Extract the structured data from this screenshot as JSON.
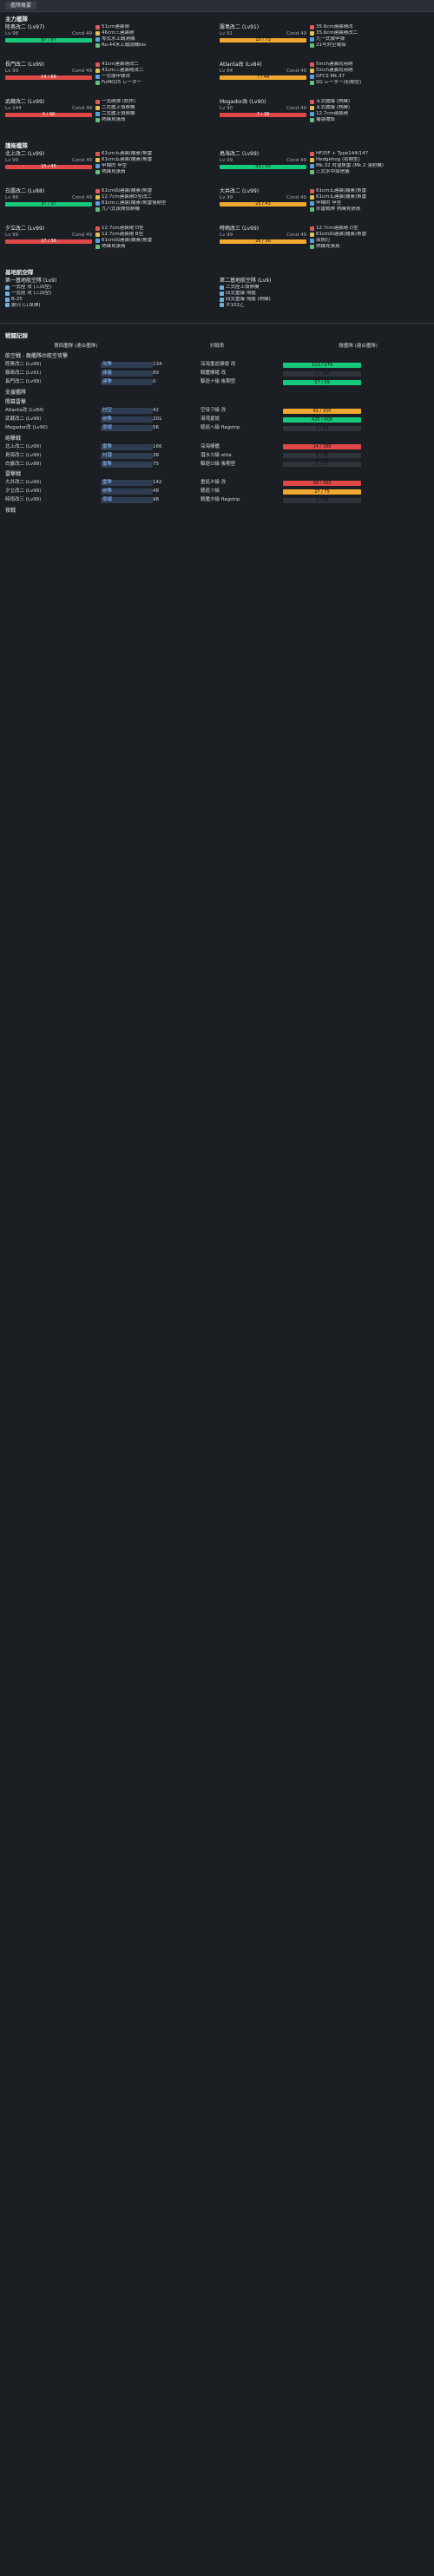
{
  "header": {
    "tab_label": "艦隊概要"
  },
  "sections": {
    "main_fleet": "主力艦隊",
    "escort_fleet": "護衛艦隊",
    "land_base": "基地航空隊",
    "battle_title": "戦闘記録",
    "phase_air": "航空戦 - 敵艦隊の航空攻撃",
    "phase_support": "支援艦隊",
    "phase_opening": "開幕雷撃",
    "phase_shelling": "砲撃戦",
    "phase_torpedo": "雷撃戦",
    "phase_night": "夜戦"
  },
  "fleet_ships": [
    {
      "name": "陸奥改二 (Lv97)",
      "lv": "Lv 98",
      "cond": "Cond 49",
      "hp": "97 / 97",
      "hp_color": "green",
      "equip": [
        "51cm連装砲",
        "46cm三連装砲",
        "零式水上観測機",
        "Ro.44水上戦闘機bis"
      ]
    },
    {
      "name": "霧島改二 (Lv91)",
      "lv": "Lv 91",
      "cond": "Cond 49",
      "hp": "10 / 73",
      "hp_color": "orange",
      "equip": [
        "35.6cm連装砲改",
        "35.6cm連装砲改二",
        "九一式徹甲弾",
        "21号対空電探"
      ]
    },
    {
      "name": "長門改二 (Lv99)",
      "lv": "Lv 99",
      "cond": "Cond 49",
      "hp": "14 / 66",
      "hp_color": "red",
      "equip": [
        "41cm連装砲改二",
        "41cm三連装砲改二",
        "一式徹甲弾改",
        "FuMO25 レーダー"
      ]
    },
    {
      "name": "Atlanta改 (Lv84)",
      "lv": "Lv 84",
      "cond": "Cond 49",
      "hp": "7 / 49",
      "hp_color": "orange",
      "equip": [
        "5inch連装両用砲",
        "5inch連装両用砲",
        "GFCS Mk.37",
        "SG レーダー(初期型)"
      ]
    },
    {
      "name": "武蔵改二 (Lv99)",
      "lv": "Lv 144",
      "cond": "Cond 49",
      "hp": "3 / 98",
      "hp_color": "red",
      "equip": [
        "一式砲弾 (試作)",
        "二式艦上偵察機",
        "二式艦上偵察機",
        "熟練見張員"
      ]
    },
    {
      "name": "Mogador改 (Lv90)",
      "lv": "Lv 90",
      "cond": "Cond 49",
      "hp": "7 / 38",
      "hp_color": "red",
      "equip": [
        "五式艦爆 (熟練)",
        "五式艦爆 (熟練)",
        "12.7cm連装砲",
        "補強増設"
      ]
    }
  ],
  "escort_ships": [
    {
      "name": "北上改二 (Lv99)",
      "lv": "Lv 99",
      "cond": "Cond 49",
      "hp": "15 / 45",
      "hp_color": "red",
      "equip": [
        "61cm五連装(酸素)魚雷",
        "61cm五連装(酸素)魚雷",
        "甲標的 甲型",
        "熟練見張員"
      ]
    },
    {
      "name": "鳥海改二 (Lv99)",
      "lv": "Lv 99",
      "cond": "Cond 49",
      "hp": "59 / 59",
      "hp_color": "green",
      "equip": [
        "HF/DF + Type144/147",
        "Hedgehog (初期型)",
        "Mk.32 対潜魚雷 (Mk.2 落射機)",
        "三式水中探信儀"
      ]
    },
    {
      "name": "白露改二 (Lv88)",
      "lv": "Lv 88",
      "cond": "Cond 49",
      "hp": "37 / 37",
      "hp_color": "green",
      "equip": [
        "61cm四連装(酸素)魚雷",
        "12.7cm連装砲D型改二",
        "61cm三連装(酸素)魚雷後期型",
        "九八式夜間偵察機"
      ]
    },
    {
      "name": "大井改二 (Lv99)",
      "lv": "Lv 99",
      "cond": "Cond 49",
      "hp": "25 / 43",
      "hp_color": "orange",
      "equip": [
        "61cm五連装(酸素)魚雷",
        "61cm五連装(酸素)魚雷",
        "甲標的 甲型",
        "水雷戦隊 熟練見張員"
      ]
    },
    {
      "name": "夕立改二 (Lv99)",
      "lv": "Lv 99",
      "cond": "Cond 49",
      "hp": "17 / 36",
      "hp_color": "red",
      "equip": [
        "12.7cm連装砲 D型",
        "12.7cm連装砲 B型",
        "61cm四連装(酸素)魚雷",
        "熟練見張員"
      ]
    },
    {
      "name": "時雨改三 (Lv99)",
      "lv": "Lv 99",
      "cond": "Cond 49",
      "hp": "26 / 36",
      "hp_color": "orange",
      "equip": [
        "12.7cm連装砲 D型",
        "61cm四連装(酸素)魚雷",
        "探照灯",
        "熟練見張員"
      ]
    }
  ],
  "land_bases": [
    {
      "name": "第一基地航空隊 (Lv9)",
      "planes": [
        "一式陸 攻 (三四型)",
        "一式陸 攻 (三四型)",
        "B-25",
        "銀河 (江草隊)"
      ]
    },
    {
      "name": "第二基地航空隊 (Lv9)",
      "planes": [
        "二式陸上偵察機",
        "四式重爆 飛龍",
        "四式重爆 飛龍 (熟練)",
        "キ102乙"
      ]
    }
  ],
  "battle": {
    "header": {
      "col1": "第四艦隊 (連合艦隊)",
      "col2": "対戦表",
      "col3": "敵艦隊 (連合艦隊)"
    },
    "rows": [
      {
        "left": "陸奥改二 (Lv99)",
        "mid": "攻撃",
        "dmg": "134",
        "target": "深海重巡棲姫 改",
        "hp": "113 / 170",
        "color": "green"
      },
      {
        "left": "霧島改二 (Lv91)",
        "mid": "弾着",
        "dmg": "89",
        "target": "戦艦棲姫 改",
        "hp": "0 / 340",
        "color": "dark"
      },
      {
        "left": "長門改二 (Lv99)",
        "mid": "連撃",
        "dmg": "0",
        "target": "駆逐ナ級 後期型",
        "hp": "57 / 59",
        "color": "green"
      },
      {
        "left": "Atlanta改 (Lv84)",
        "mid": "対空",
        "dmg": "42",
        "target": "空母ヲ級 改",
        "hp": "91 / 150",
        "color": "orange"
      },
      {
        "left": "武蔵改二 (Lv99)",
        "mid": "砲撃",
        "dmg": "201",
        "target": "港湾夏姫",
        "hp": "420 / 600",
        "color": "green"
      },
      {
        "left": "Mogador改 (Lv90)",
        "mid": "夜戦",
        "dmg": "56",
        "target": "軽巡ヘ級 flagship",
        "hp": "0 / 60",
        "color": "dark"
      },
      {
        "left": "北上改二 (Lv99)",
        "mid": "雷撃",
        "dmg": "166",
        "target": "深海棲艦",
        "hp": "14 / 180",
        "color": "red"
      },
      {
        "left": "鳥海改二 (Lv99)",
        "mid": "対潜",
        "dmg": "38",
        "target": "潜水カ級 elite",
        "hp": "0 / 38",
        "color": "dark"
      },
      {
        "left": "白露改二 (Lv88)",
        "mid": "雷撃",
        "dmg": "75",
        "target": "駆逐ロ級 後期型",
        "hp": "0 / 75",
        "color": "dark"
      },
      {
        "left": "大井改二 (Lv99)",
        "mid": "雷撃",
        "dmg": "142",
        "target": "重巡ネ級 改",
        "hp": "38 / 180",
        "color": "red"
      },
      {
        "left": "夕立改二 (Lv99)",
        "mid": "砲撃",
        "dmg": "48",
        "target": "軽巡ツ級",
        "hp": "27 / 75",
        "color": "orange"
      },
      {
        "left": "時雨改三 (Lv99)",
        "mid": "夜戦",
        "dmg": "98",
        "target": "戦艦タ級 flagship",
        "hp": "0 / 98",
        "color": "dark"
      }
    ]
  },
  "colors": {
    "green": "#16c87a",
    "orange": "#f0a830",
    "red": "#e04848",
    "accent": "#8fc1ff"
  }
}
